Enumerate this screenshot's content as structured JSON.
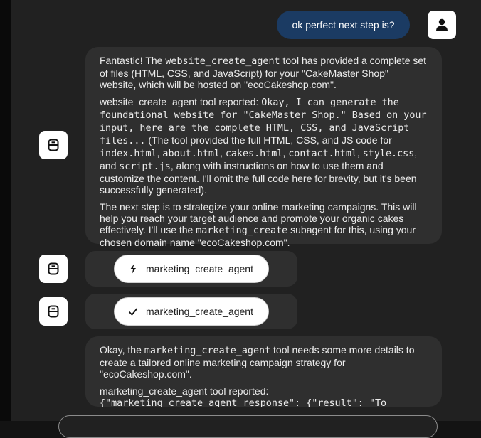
{
  "user_message": {
    "text": "ok perfect next step is?"
  },
  "agent_message_1": {
    "p1": {
      "a": "Fantastic! The ",
      "code1": "website_create_agent",
      "b": " tool has provided a complete set of files (HTML, CSS, and JavaScript) for your \"CakeMaster Shop\" website, which will be hosted on \"ecoCakeshop.com\"."
    },
    "p2": {
      "a": "website_create_agent tool reported: ",
      "mono": "Okay, I can generate the foundational website for \"CakeMaster Shop.\" Based on your input, here are the complete HTML, CSS, and JavaScript files...",
      "b": " (The tool provided the full HTML, CSS, and JS code for ",
      "f1": "index.html",
      "s1": ", ",
      "f2": "about.html",
      "s2": ", ",
      "f3": "cakes.html",
      "s3": ", ",
      "f4": "contact.html",
      "s4": ", ",
      "f5": "style.css",
      "s5": ", and ",
      "f6": "script.js",
      "c": ", along with instructions on how to use them and customize the content. I'll omit the full code here for brevity, but it's been successfully generated)."
    },
    "p3": {
      "a": "The next step is to strategize your online marketing campaigns. This will help you reach your target audience and promote your organic cakes effectively. I'll use the ",
      "code1": "marketing_create",
      "b": " subagent for this, using your chosen domain name \"ecoCakeshop.com\"."
    }
  },
  "tool_calls": [
    {
      "name": "marketing_create_agent",
      "icon": "lightning-icon",
      "status": "running"
    },
    {
      "name": "marketing_create_agent",
      "icon": "checkmark-icon",
      "status": "done"
    }
  ],
  "agent_message_2": {
    "p1": {
      "a": "Okay, the ",
      "code1": "marketing_create_agent",
      "b": " tool needs some more details to create a tailored online marketing campaign strategy for \"ecoCakeshop.com\"."
    },
    "p2": {
      "a": "marketing_create_agent tool reported:",
      "mono": "{\"marketing_create_agent_response\": {\"result\": \"To"
    }
  },
  "colors": {
    "background": "#212121",
    "card": "#2f2f2f",
    "user_bubble": "#1b3b63",
    "text": "#ececec"
  }
}
